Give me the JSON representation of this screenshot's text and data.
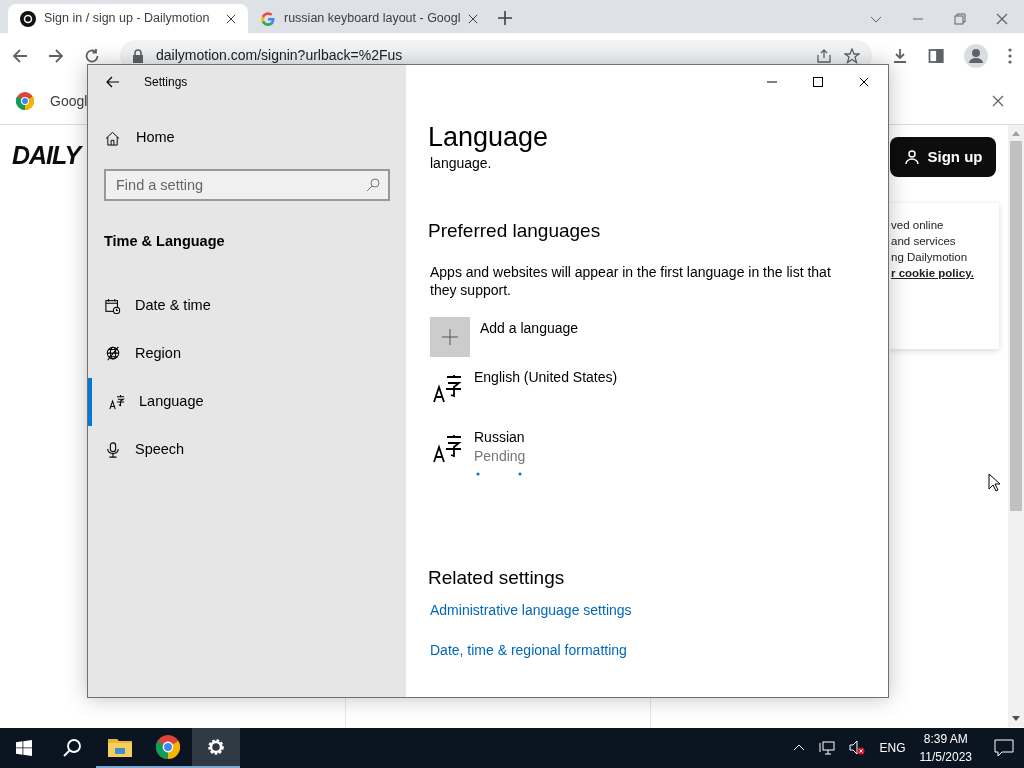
{
  "browser": {
    "tabs": [
      {
        "title": "Sign in / sign up - Dailymotion",
        "selected": true
      },
      {
        "title": "russian keyboard layout - Googl",
        "selected": false
      }
    ],
    "url": "dailymotion.com/signin?urlback=%2Fus",
    "infobar": {
      "text": "Googl"
    }
  },
  "page": {
    "logo": "DAILY",
    "signup_button": "Sign up",
    "cookie_lines": [
      "ved online",
      "and services",
      "ng Dailymotion"
    ],
    "cookie_link": "r cookie policy."
  },
  "settings": {
    "window_title": "Settings",
    "home": "Home",
    "search": {
      "placeholder": "Find a setting"
    },
    "section": "Time & Language",
    "nav": [
      {
        "kind": "calendar",
        "label": "Date & time",
        "selected": false
      },
      {
        "kind": "globe",
        "label": "Region",
        "selected": false
      },
      {
        "kind": "language",
        "label": "Language",
        "selected": true
      },
      {
        "kind": "mic",
        "label": "Speech",
        "selected": false
      }
    ],
    "heading": "Language",
    "intro_tail": "language.",
    "preferred_title": "Preferred languages",
    "preferred_desc": "Apps and websites will appear in the first language in the list that they support.",
    "add_language": "Add a language",
    "languages": [
      {
        "name": "English (United States)",
        "in_progress": false
      },
      {
        "name": "Russian",
        "status": "Pending",
        "in_progress": true
      }
    ],
    "related_title": "Related settings",
    "related_links": [
      "Administrative language settings",
      "Date, time & regional formatting"
    ]
  },
  "taskbar": {
    "language": "ENG",
    "time": "8:39 AM",
    "date": "11/5/2023",
    "apps": [
      {
        "kind": "folder",
        "selected": false
      },
      {
        "kind": "chrome",
        "selected": false
      },
      {
        "kind": "settings",
        "selected": true
      }
    ]
  }
}
